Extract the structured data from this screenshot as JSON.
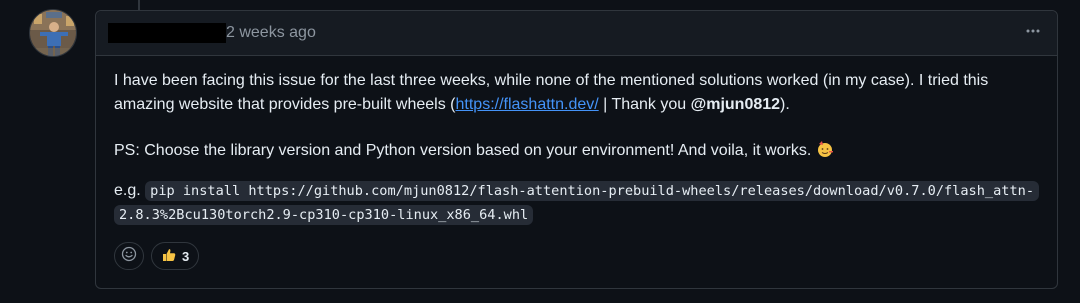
{
  "comment": {
    "author": "",
    "timestamp": "2 weeks ago",
    "menu_icon": "kebab-horizontal-icon",
    "body": {
      "p1_text1": "I have been facing this issue for the last three weeks, while none of the mentioned solutions worked (in my case). I tried this amazing website that provides pre-built wheels (",
      "p1_link": "https://flashattn.dev/",
      "p1_text2": " | Thank you ",
      "p1_mention": "@mjun0812",
      "p1_text3": ").",
      "p2_text": "PS: Choose the library version and Python version based on your environment! And voila, it works. ",
      "p2_emoji": "partying-face-icon",
      "p3_prefix": "e.g. ",
      "p3_code_line1": "pip install https://github.com/mjun0812/flash-attention-prebuild-wheels/releases/download/v0.7.0/flash_attn-",
      "p3_code_line2": "2.8.3%2Bcu130torch2.9-cp310-cp310-linux_x86_64.whl"
    },
    "reactions": {
      "add_icon": "smiley-icon",
      "thumbs_up_icon": "thumbs-up-icon",
      "thumbs_up_count": "3"
    }
  },
  "colors": {
    "background": "#0d1117",
    "header_bg": "#161b22",
    "border": "#30363d",
    "text": "#e6edf3",
    "muted": "#8d96a0",
    "link": "#4493f8",
    "code_bg": "#262c36"
  }
}
